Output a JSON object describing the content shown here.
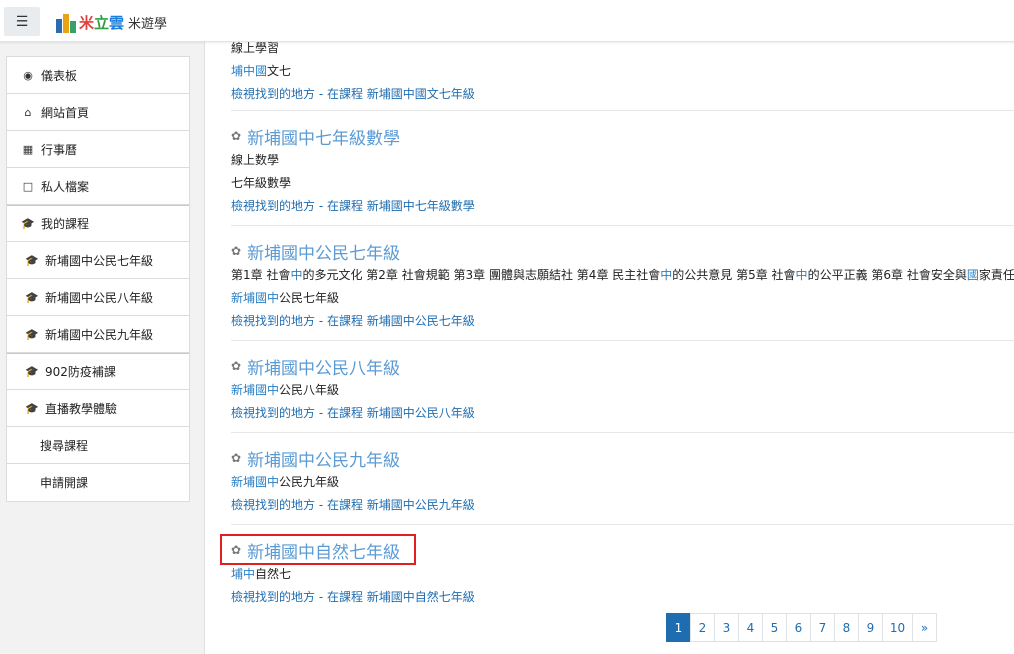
{
  "navbar": {
    "menu_icon": "hamburger-icon",
    "logo_part1": "米",
    "logo_part2": "立",
    "logo_part3": "雲",
    "logo_sub": "米遊學"
  },
  "drawer": {
    "items": [
      {
        "label": "儀表板",
        "icon": "dashboard-icon"
      },
      {
        "label": "網站首頁",
        "icon": "home-icon"
      },
      {
        "label": "行事曆",
        "icon": "calendar-icon"
      },
      {
        "label": "私人檔案",
        "icon": "file-icon"
      },
      {
        "label": "我的課程",
        "icon": "graduation-cap-icon"
      },
      {
        "label": "新埔國中公民七年級",
        "icon": "graduation-cap-icon"
      },
      {
        "label": "新埔國中公民八年級",
        "icon": "graduation-cap-icon"
      },
      {
        "label": "新埔國中公民九年級",
        "icon": "graduation-cap-icon"
      },
      {
        "label": "902防疫補課",
        "icon": "graduation-cap-icon"
      },
      {
        "label": "直播教學體驗",
        "icon": "graduation-cap-icon"
      },
      {
        "label": "搜尋課程"
      },
      {
        "label": "申請開課"
      }
    ]
  },
  "courses": [
    {
      "lines": [
        "線上學習"
      ],
      "summary_hl": "埔中國",
      "summary_rest": "文七",
      "found_link": "檢視找到的地方 - 在課程 新埔國中國文七年級"
    },
    {
      "title": "新埔國中七年級數學",
      "lines": [
        "線上数學",
        "七年級數學"
      ],
      "found_link": "檢視找到的地方 - 在課程 新埔國中七年級數學"
    },
    {
      "title": "新埔國中公民七年級",
      "summary_parts": [
        "第1章 社會",
        "中",
        "的多元文化 第2章 社會規範 第3章 團體與志願結社 第4章 民主社會",
        "中",
        "的公共意見 第5章 社會",
        "中",
        "的公平正義 第6章 社會安全與",
        "國",
        "家責任"
      ],
      "summary_hl": "新埔國中",
      "summary_rest": "公民七年級",
      "found_link": "檢視找到的地方 - 在課程 新埔國中公民七年級"
    },
    {
      "title": "新埔國中公民八年級",
      "summary_hl": "新埔國中",
      "summary_rest": "公民八年級",
      "found_link": "檢視找到的地方 - 在課程 新埔國中公民八年級"
    },
    {
      "title": "新埔國中公民九年級",
      "summary_hl": "新埔國中",
      "summary_rest": "公民九年級",
      "found_link": "檢視找到的地方 - 在課程 新埔國中公民九年級"
    },
    {
      "title": "新埔國中自然七年級",
      "summary_hl": "埔中",
      "summary_rest": "自然七",
      "found_link": "檢視找到的地方 - 在課程 新埔國中自然七年級"
    }
  ],
  "pagination": {
    "pages": [
      "1",
      "2",
      "3",
      "4",
      "5",
      "6",
      "7",
      "8",
      "9",
      "10"
    ],
    "current": "1",
    "next": "»"
  },
  "colors": {
    "accent": "#1f6db1",
    "title_link": "#5b9bd5",
    "highlight_border": "#e02020"
  }
}
